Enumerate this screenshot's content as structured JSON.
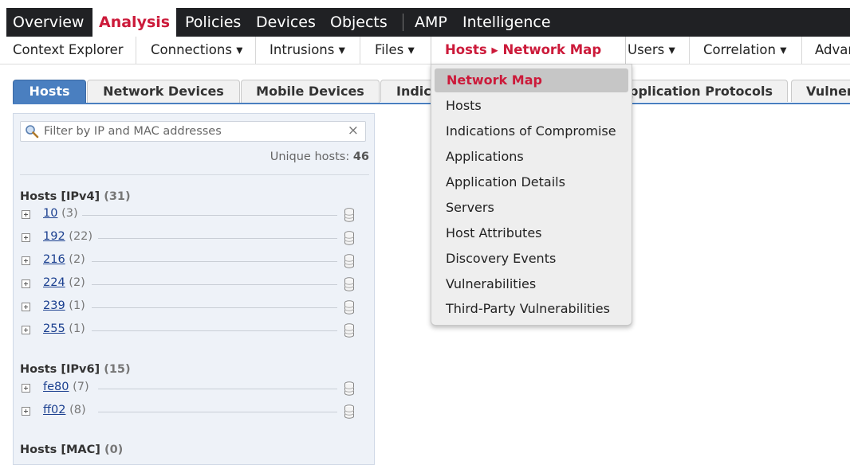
{
  "top_nav": [
    "Overview",
    "Analysis",
    "Policies",
    "Devices",
    "Objects",
    "AMP",
    "Intelligence"
  ],
  "sub_nav": [
    "Context Explorer",
    "Connections ▾",
    "Intrusions ▾",
    "Files ▾",
    "Hosts ▸ Network Map",
    "Users ▾",
    "Correlation ▾",
    "Advar"
  ],
  "tabs": [
    "Hosts",
    "Network Devices",
    "Mobile Devices",
    "Indic",
    "pplication Protocols",
    "Vulner"
  ],
  "filter_placeholder": "Filter by IP and MAC addresses",
  "clear_icon": "×",
  "unique_hosts_label": "Unique hosts:",
  "unique_hosts_count": "46",
  "groups": [
    {
      "title": "Hosts [IPv4]",
      "count": "(31)",
      "items": [
        {
          "label": "10",
          "count": "(3)"
        },
        {
          "label": "192",
          "count": "(22)"
        },
        {
          "label": "216",
          "count": "(2)"
        },
        {
          "label": "224",
          "count": "(2)"
        },
        {
          "label": "239",
          "count": "(1)"
        },
        {
          "label": "255",
          "count": "(1)"
        }
      ]
    },
    {
      "title": "Hosts [IPv6]",
      "count": "(15)",
      "items": [
        {
          "label": "fe80",
          "count": "(7)"
        },
        {
          "label": "ff02",
          "count": "(8)"
        }
      ]
    },
    {
      "title": "Hosts [MAC]",
      "count": "(0)",
      "items": []
    }
  ],
  "dropdown": [
    "Network Map",
    "Hosts",
    "Indications of Compromise",
    "Applications",
    "Application Details",
    "Servers",
    "Host Attributes",
    "Discovery Events",
    "Vulnerabilities",
    "Third-Party Vulnerabilities"
  ],
  "icons": {
    "search": "search-icon",
    "clear": "close-icon",
    "expand": "expand-icon",
    "database": "database-icon"
  },
  "colors": {
    "accent": "#cc1a3a",
    "tab_active": "#4a7fc0",
    "nav_bg": "#202124"
  }
}
